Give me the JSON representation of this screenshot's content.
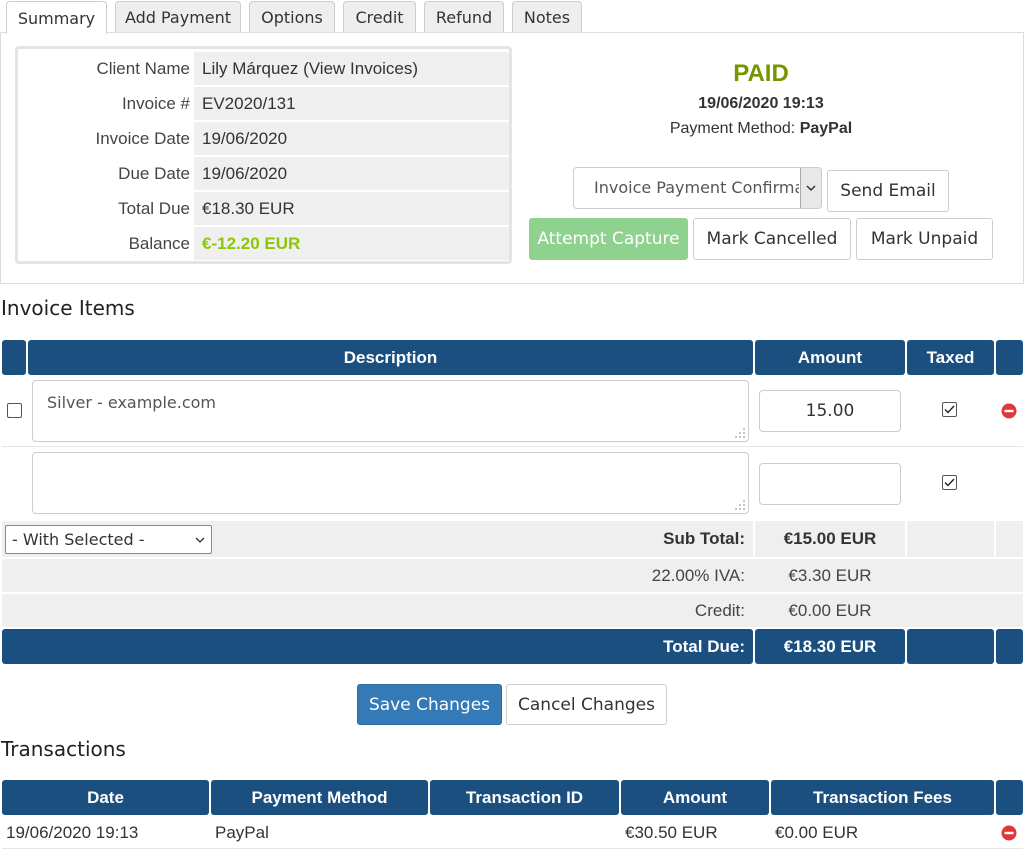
{
  "tabs": [
    "Summary",
    "Add Payment",
    "Options",
    "Credit",
    "Refund",
    "Notes"
  ],
  "summary": {
    "labels": {
      "client_name": "Client Name",
      "invoice_num": "Invoice #",
      "invoice_date": "Invoice Date",
      "due_date": "Due Date",
      "total_due": "Total Due",
      "balance": "Balance"
    },
    "values": {
      "client_name": "Lily Márquez (View Invoices)",
      "invoice_num": "EV2020/131",
      "invoice_date": "19/06/2020",
      "due_date": "19/06/2020",
      "total_due": "€18.30 EUR",
      "balance": "€-12.20 EUR"
    },
    "status": "PAID",
    "paid_datetime": "19/06/2020 19:13",
    "payment_method_label": "Payment Method:",
    "payment_method": "PayPal",
    "email_template": "Invoice Payment Confirmation",
    "buttons": {
      "send_email": "Send Email",
      "attempt_capture": "Attempt Capture",
      "mark_cancelled": "Mark Cancelled",
      "mark_unpaid": "Mark Unpaid"
    }
  },
  "invoice_items": {
    "title": "Invoice Items",
    "headers": {
      "description": "Description",
      "amount": "Amount",
      "taxed": "Taxed"
    },
    "rows": [
      {
        "description": "Silver - example.com",
        "amount": "15.00",
        "taxed": true,
        "selected": false
      },
      {
        "description": "",
        "amount": "",
        "taxed": true
      }
    ],
    "with_selected": "- With Selected -",
    "subtotal_label": "Sub Total:",
    "subtotal": "€15.00 EUR",
    "tax_label": "22.00% IVA:",
    "tax": "€3.30 EUR",
    "credit_label": "Credit:",
    "credit": "€0.00 EUR",
    "total_label": "Total Due:",
    "total": "€18.30 EUR"
  },
  "actions": {
    "save": "Save Changes",
    "cancel": "Cancel Changes"
  },
  "transactions": {
    "title": "Transactions",
    "headers": {
      "date": "Date",
      "method": "Payment Method",
      "txn_id": "Transaction ID",
      "amount": "Amount",
      "fees": "Transaction Fees"
    },
    "rows": [
      {
        "date": "19/06/2020 19:13",
        "method": "PayPal",
        "txn_id": "",
        "amount": "€30.50 EUR",
        "fees": "€0.00 EUR"
      }
    ]
  },
  "colors": {
    "header_blue": "#1b4f80",
    "paid_green": "#779500",
    "balance_green": "#8cc800",
    "primary_blue": "#337ab7",
    "success_green": "#8fd18f",
    "delete_red": "#e0383a"
  }
}
